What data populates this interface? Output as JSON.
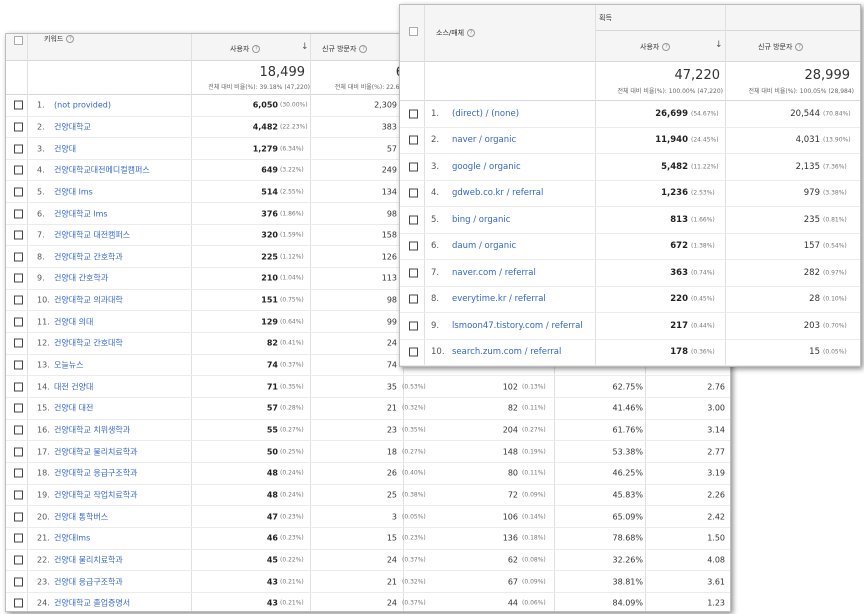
{
  "keyword_table": {
    "col_keyword": "키워드",
    "col_users": "사용자",
    "col_new": "신규 방문자",
    "total_users": "18,499",
    "total_users_sub": "전체 대비 비율(%): 39.18% (47,220)",
    "total_new": "6",
    "total_new_sub": "전체 대비 비율(%): 22.68%",
    "rows": [
      {
        "n": "1.",
        "kw": "(not provided)",
        "users": "6,050",
        "up": "(30.00%)",
        "nv": "2,309",
        "np": "",
        "s": "",
        "sp": "",
        "b": "",
        "d": ""
      },
      {
        "n": "2.",
        "kw": "건양대학교",
        "users": "4,482",
        "up": "(22.23%)",
        "nv": "383",
        "np": "",
        "s": "",
        "sp": "",
        "b": "",
        "d": ""
      },
      {
        "n": "3.",
        "kw": "건양대",
        "users": "1,279",
        "up": "(6.34%)",
        "nv": "57",
        "np": "",
        "s": "",
        "sp": "",
        "b": "",
        "d": ""
      },
      {
        "n": "4.",
        "kw": "건양대학교대전메디컬캠퍼스",
        "users": "649",
        "up": "(3.22%)",
        "nv": "249",
        "np": "",
        "s": "",
        "sp": "",
        "b": "",
        "d": ""
      },
      {
        "n": "5.",
        "kw": "건양대 lms",
        "users": "514",
        "up": "(2.55%)",
        "nv": "134",
        "np": "",
        "s": "",
        "sp": "",
        "b": "",
        "d": ""
      },
      {
        "n": "6.",
        "kw": "건양대학교 lms",
        "users": "376",
        "up": "(1.86%)",
        "nv": "98",
        "np": "",
        "s": "",
        "sp": "",
        "b": "",
        "d": ""
      },
      {
        "n": "7.",
        "kw": "건양대학교 대전캠퍼스",
        "users": "320",
        "up": "(1.59%)",
        "nv": "158",
        "np": "",
        "s": "",
        "sp": "",
        "b": "",
        "d": ""
      },
      {
        "n": "8.",
        "kw": "건양대학교 간호학과",
        "users": "225",
        "up": "(1.12%)",
        "nv": "126",
        "np": "",
        "s": "",
        "sp": "",
        "b": "",
        "d": ""
      },
      {
        "n": "9.",
        "kw": "건양대 간호학과",
        "users": "210",
        "up": "(1.04%)",
        "nv": "113",
        "np": "",
        "s": "",
        "sp": "",
        "b": "",
        "d": ""
      },
      {
        "n": "10.",
        "kw": "건양대학교 의과대학",
        "users": "151",
        "up": "(0.75%)",
        "nv": "98",
        "np": "",
        "s": "",
        "sp": "",
        "b": "",
        "d": ""
      },
      {
        "n": "11.",
        "kw": "건양대 의대",
        "users": "129",
        "up": "(0.64%)",
        "nv": "99",
        "np": "",
        "s": "",
        "sp": "",
        "b": "",
        "d": ""
      },
      {
        "n": "12.",
        "kw": "건양대학교 간호대학",
        "users": "82",
        "up": "(0.41%)",
        "nv": "24",
        "np": "",
        "s": "",
        "sp": "",
        "b": "",
        "d": ""
      },
      {
        "n": "13.",
        "kw": "오늘뉴스",
        "users": "74",
        "up": "(0.37%)",
        "nv": "74",
        "np": "",
        "s": "",
        "sp": "",
        "b": "",
        "d": ""
      },
      {
        "n": "14.",
        "kw": "대전 건양대",
        "users": "71",
        "up": "(0.35%)",
        "nv": "35",
        "np": "(0.53%)",
        "s": "102",
        "sp": "(0.13%)",
        "b": "62.75%",
        "d": "2.76"
      },
      {
        "n": "15.",
        "kw": "건양대 대전",
        "users": "57",
        "up": "(0.28%)",
        "nv": "21",
        "np": "(0.32%)",
        "s": "82",
        "sp": "(0.11%)",
        "b": "41.46%",
        "d": "3.00"
      },
      {
        "n": "16.",
        "kw": "건양대학교 치위생학과",
        "users": "55",
        "up": "(0.27%)",
        "nv": "23",
        "np": "(0.35%)",
        "s": "204",
        "sp": "(0.27%)",
        "b": "61.76%",
        "d": "3.14"
      },
      {
        "n": "17.",
        "kw": "건양대학교 물리치료학과",
        "users": "50",
        "up": "(0.25%)",
        "nv": "18",
        "np": "(0.27%)",
        "s": "148",
        "sp": "(0.19%)",
        "b": "53.38%",
        "d": "2.77"
      },
      {
        "n": "18.",
        "kw": "건양대학교 응급구조학과",
        "users": "48",
        "up": "(0.24%)",
        "nv": "26",
        "np": "(0.40%)",
        "s": "80",
        "sp": "(0.11%)",
        "b": "46.25%",
        "d": "3.19"
      },
      {
        "n": "19.",
        "kw": "건양대학교 작업치료학과",
        "users": "48",
        "up": "(0.24%)",
        "nv": "25",
        "np": "(0.38%)",
        "s": "72",
        "sp": "(0.09%)",
        "b": "45.83%",
        "d": "2.26"
      },
      {
        "n": "20.",
        "kw": "건양대 통학버스",
        "users": "47",
        "up": "(0.23%)",
        "nv": "3",
        "np": "(0.05%)",
        "s": "106",
        "sp": "(0.14%)",
        "b": "65.09%",
        "d": "2.42"
      },
      {
        "n": "21.",
        "kw": "건양대lms",
        "users": "46",
        "up": "(0.23%)",
        "nv": "15",
        "np": "(0.23%)",
        "s": "136",
        "sp": "(0.18%)",
        "b": "78.68%",
        "d": "1.50"
      },
      {
        "n": "22.",
        "kw": "건양대 물리치료학과",
        "users": "45",
        "up": "(0.22%)",
        "nv": "24",
        "np": "(0.37%)",
        "s": "62",
        "sp": "(0.08%)",
        "b": "32.26%",
        "d": "4.08"
      },
      {
        "n": "23.",
        "kw": "건양대 응급구조학과",
        "users": "43",
        "up": "(0.21%)",
        "nv": "21",
        "np": "(0.32%)",
        "s": "67",
        "sp": "(0.09%)",
        "b": "38.81%",
        "d": "3.61"
      },
      {
        "n": "24.",
        "kw": "건양대학교 졸업증명서",
        "users": "43",
        "up": "(0.21%)",
        "nv": "24",
        "np": "(0.37%)",
        "s": "44",
        "sp": "(0.06%)",
        "b": "84.09%",
        "d": "1.23"
      }
    ]
  },
  "source_table": {
    "group_label": "획득",
    "col_source": "소스/매체",
    "col_users": "사용자",
    "col_new": "신규 방문자",
    "total_users": "47,220",
    "total_users_sub": "전체 대비 비율(%): 100.00% (47,220)",
    "total_new": "28,999",
    "total_new_sub": "전체 대비 비율(%): 100.05% (28,984)",
    "rows": [
      {
        "n": "1.",
        "src": "(direct) / (none)",
        "users": "26,699",
        "up": "(54.67%)",
        "nv": "20,544",
        "np": "(70.84%)"
      },
      {
        "n": "2.",
        "src": "naver / organic",
        "users": "11,940",
        "up": "(24.45%)",
        "nv": "4,031",
        "np": "(13.90%)"
      },
      {
        "n": "3.",
        "src": "google / organic",
        "users": "5,482",
        "up": "(11.22%)",
        "nv": "2,135",
        "np": "(7.36%)"
      },
      {
        "n": "4.",
        "src": "gdweb.co.kr / referral",
        "users": "1,236",
        "up": "(2.53%)",
        "nv": "979",
        "np": "(3.38%)"
      },
      {
        "n": "5.",
        "src": "bing / organic",
        "users": "813",
        "up": "(1.66%)",
        "nv": "235",
        "np": "(0.81%)"
      },
      {
        "n": "6.",
        "src": "daum / organic",
        "users": "672",
        "up": "(1.38%)",
        "nv": "157",
        "np": "(0.54%)"
      },
      {
        "n": "7.",
        "src": "naver.com / referral",
        "users": "363",
        "up": "(0.74%)",
        "nv": "282",
        "np": "(0.97%)"
      },
      {
        "n": "8.",
        "src": "everytime.kr / referral",
        "users": "220",
        "up": "(0.45%)",
        "nv": "28",
        "np": "(0.10%)"
      },
      {
        "n": "9.",
        "src": "lsmoon47.tistory.com / referral",
        "users": "217",
        "up": "(0.44%)",
        "nv": "203",
        "np": "(0.70%)"
      },
      {
        "n": "10.",
        "src": "search.zum.com / referral",
        "users": "178",
        "up": "(0.36%)",
        "nv": "15",
        "np": "(0.05%)"
      }
    ]
  }
}
